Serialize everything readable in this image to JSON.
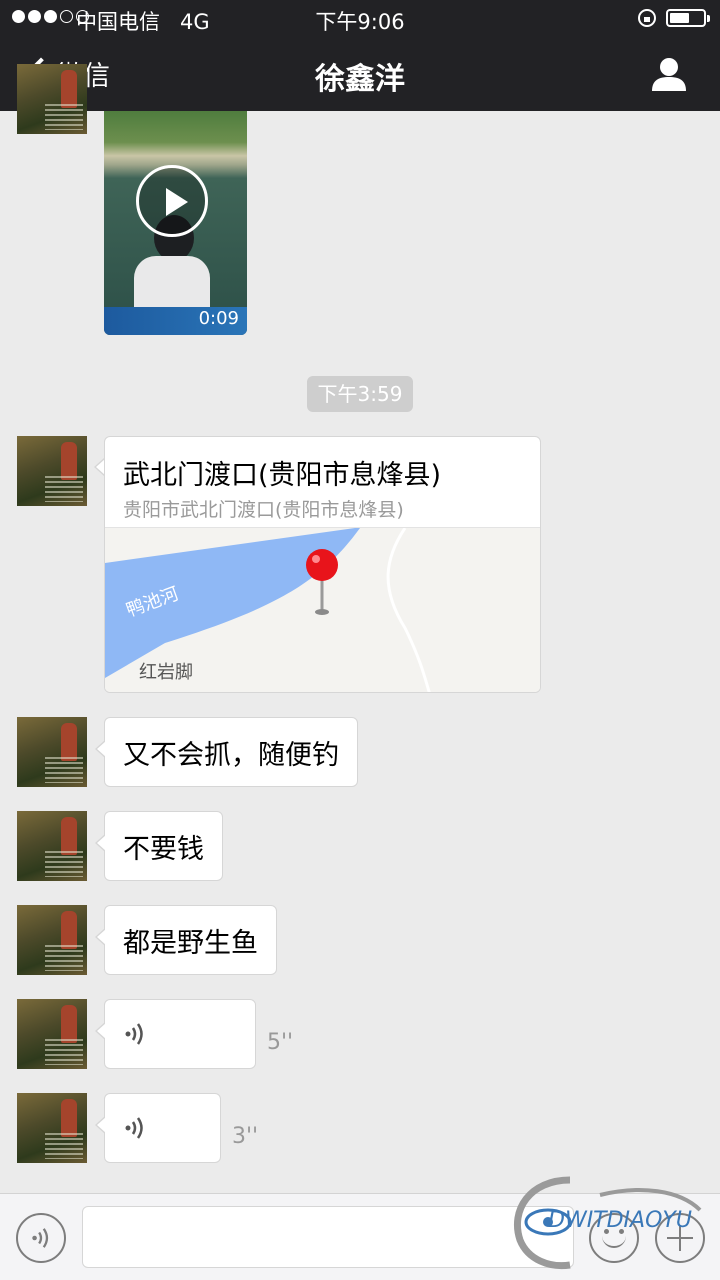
{
  "status_bar": {
    "signal": "●●●○○",
    "carrier": "中国电信",
    "network": "4G",
    "time": "下午9:06",
    "battery_level": 0.6
  },
  "nav": {
    "back_label": "微信",
    "title": "徐鑫洋",
    "profile_icon": "person-icon"
  },
  "messages": {
    "video": {
      "duration": "0:09"
    },
    "timestamp": "下午3:59",
    "location": {
      "title": "武北门渡口(贵阳市息烽县)",
      "subtitle": "贵阳市武北门渡口(贵阳市息烽县)",
      "map_river_label": "鸭池河",
      "map_place_label": "红岩脚"
    },
    "text_1": "又不会抓，随便钓",
    "text_2": "不要钱",
    "text_3": "都是野生鱼",
    "voice_1": {
      "duration": "5''"
    },
    "voice_2": {
      "duration": "3''"
    }
  },
  "input_bar": {
    "voice_icon": "voice-icon",
    "emoji_icon": "emoji-icon",
    "plus_icon": "plus-icon"
  },
  "watermark": {
    "text": "DWITDIAOYU"
  },
  "colors": {
    "nav_bg": "#222225",
    "chat_bg": "#ebebeb",
    "river": "#8fb8f5",
    "pin": "#e8141b"
  }
}
